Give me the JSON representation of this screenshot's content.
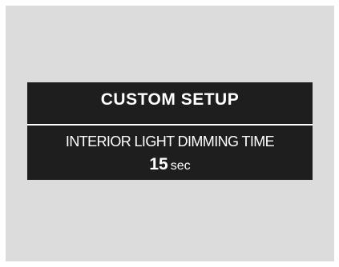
{
  "screen": {
    "title": "CUSTOM SETUP",
    "setting": {
      "label": "INTERIOR LIGHT DIMMING TIME",
      "value": "15",
      "unit": "sec"
    }
  },
  "colors": {
    "frame_background": "#dcdcdc",
    "display_background": "#1e1e1e",
    "text": "#ffffff"
  }
}
